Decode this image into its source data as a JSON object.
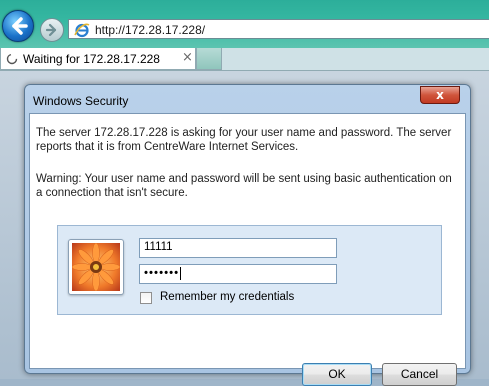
{
  "browser": {
    "address": "http://172.28.17.228/",
    "tab_label": "Waiting for 172.28.17.228",
    "tab_close": "×"
  },
  "dialog": {
    "title": "Windows Security",
    "close_label": "x",
    "message": "The server 172.28.17.228 is asking for your user name and password. The server reports that it is from CentreWare Internet Services.",
    "warning": "Warning: Your user name and password will be sent using basic authentication on a connection that isn't secure.",
    "username_value": "11111",
    "password_value": "•••••••",
    "remember_label": "Remember my credentials",
    "remember_checked": false,
    "ok_label": "OK",
    "cancel_label": "Cancel"
  },
  "icons": {
    "back": "back-arrow-icon",
    "forward": "forward-arrow-icon",
    "page": "internet-explorer-icon",
    "spinner": "loading-spinner-icon",
    "avatar": "user-flower-picture"
  }
}
